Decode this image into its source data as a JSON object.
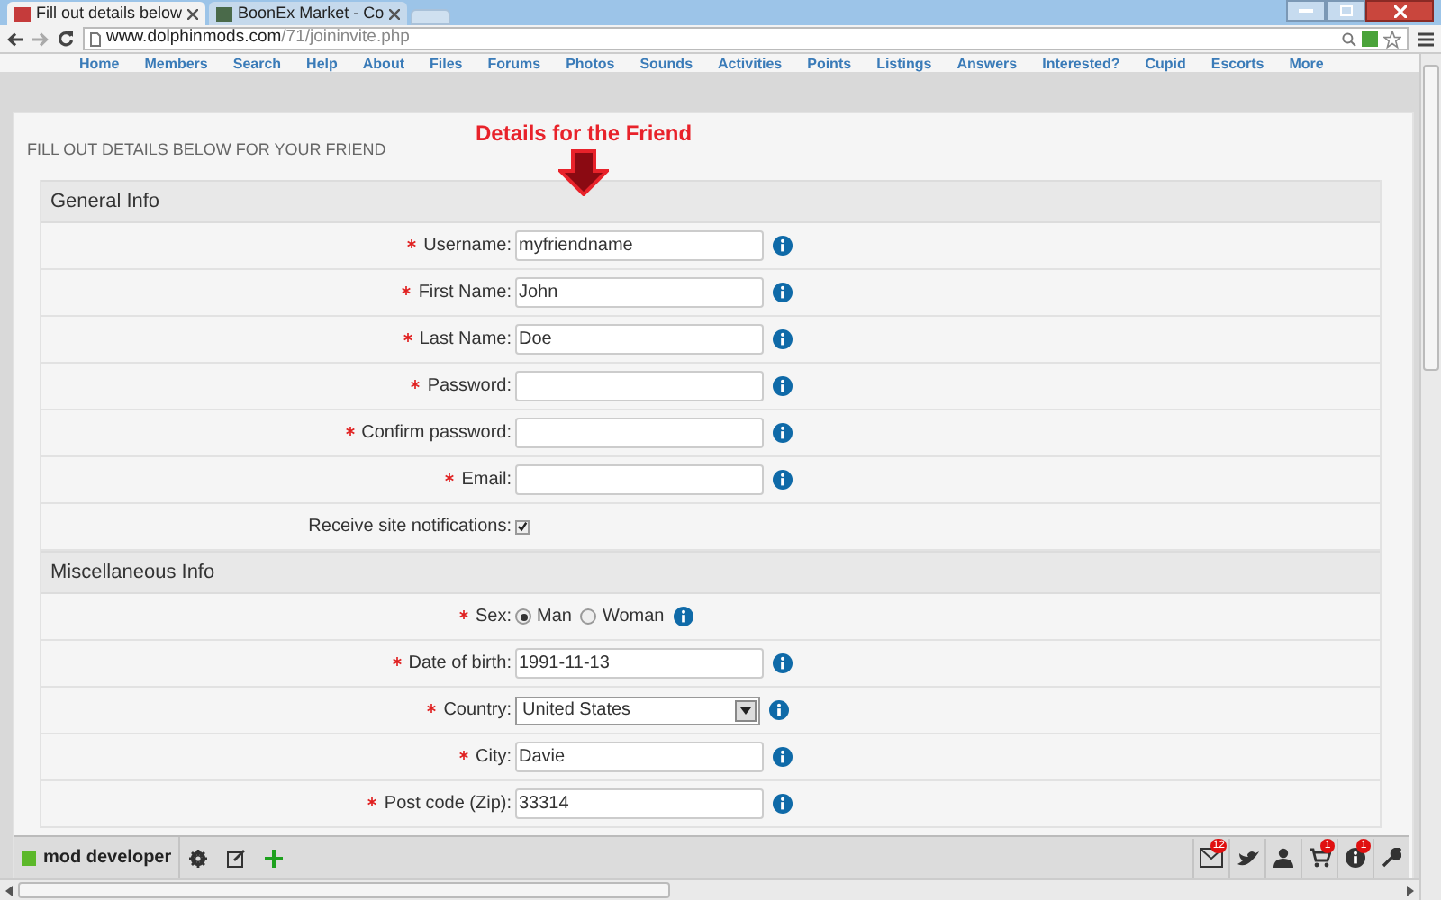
{
  "browser": {
    "tabs": [
      {
        "title": "Fill out details below",
        "selected": true
      },
      {
        "title": "BoonEx Market - Co",
        "selected": false
      }
    ],
    "url": {
      "host": "www.dolphinmods.com",
      "path": "/71/joininvite.php"
    }
  },
  "nav": [
    "Home",
    "Members",
    "Search",
    "Help",
    "About",
    "Files",
    "Forums",
    "Photos",
    "Sounds",
    "Activities",
    "Points",
    "Listings",
    "Answers",
    "Interested?",
    "Cupid",
    "Escorts",
    "More"
  ],
  "page": {
    "heading": "FILL OUT DETAILS BELOW FOR YOUR FRIEND",
    "annotation": "Details for the Friend",
    "sections": [
      {
        "title": "General Info",
        "rows": [
          {
            "kind": "text",
            "label": "Username:",
            "required": true,
            "value": "myfriendname"
          },
          {
            "kind": "text",
            "label": "First Name:",
            "required": true,
            "value": "John"
          },
          {
            "kind": "text",
            "label": "Last Name:",
            "required": true,
            "value": "Doe"
          },
          {
            "kind": "text",
            "label": "Password:",
            "required": true,
            "value": ""
          },
          {
            "kind": "text",
            "label": "Confirm password:",
            "required": true,
            "value": ""
          },
          {
            "kind": "text",
            "label": "Email:",
            "required": true,
            "value": ""
          },
          {
            "kind": "checkbox",
            "label": "Receive site notifications:",
            "required": false,
            "checked": true
          }
        ]
      },
      {
        "title": "Miscellaneous Info",
        "rows": [
          {
            "kind": "radio",
            "label": "Sex:",
            "required": true,
            "options": [
              {
                "label": "Man",
                "selected": true
              },
              {
                "label": "Woman",
                "selected": false
              }
            ]
          },
          {
            "kind": "text",
            "label": "Date of birth:",
            "required": true,
            "value": "1991-11-13"
          },
          {
            "kind": "select",
            "label": "Country:",
            "required": true,
            "value": "United States"
          },
          {
            "kind": "text",
            "label": "City:",
            "required": true,
            "value": "Davie"
          },
          {
            "kind": "text",
            "label": "Post code (Zip):",
            "required": true,
            "value": "33314"
          }
        ]
      }
    ]
  },
  "toolbar": {
    "user": "mod developer",
    "badges": [
      {
        "kind": "mail",
        "count": "12"
      },
      {
        "kind": "bird"
      },
      {
        "kind": "person"
      },
      {
        "kind": "cart",
        "count": "1"
      },
      {
        "kind": "info",
        "count": "1"
      },
      {
        "kind": "wrench"
      }
    ]
  }
}
